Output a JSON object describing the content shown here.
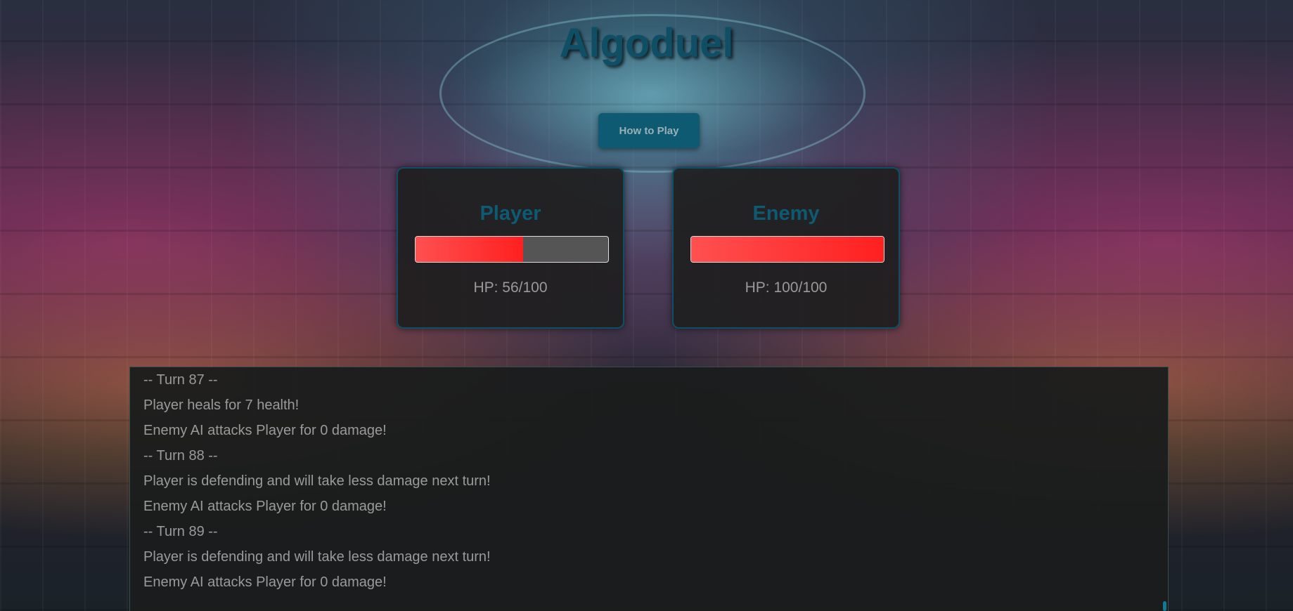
{
  "title": "Algoduel",
  "how_to_play_label": "How to Play",
  "player": {
    "name": "Player",
    "hp_text": "HP: 56/100",
    "hp": 56,
    "hp_max": 100
  },
  "enemy": {
    "name": "Enemy",
    "hp_text": "HP: 100/100",
    "hp": 100,
    "hp_max": 100
  },
  "log": [
    "-- Turn 87 --",
    "Player heals for 7 health!",
    "Enemy AI attacks Player for 0 damage!",
    "-- Turn 88 --",
    "Player is defending and will take less damage next turn!",
    "Enemy AI attacks Player for 0 damage!",
    "-- Turn 89 --",
    "Player is defending and will take less damage next turn!",
    "Enemy AI attacks Player for 0 damage!"
  ],
  "colors": {
    "accent": "#0e5a72",
    "hp_fill": "#ff2020",
    "hp_track": "#555555"
  }
}
